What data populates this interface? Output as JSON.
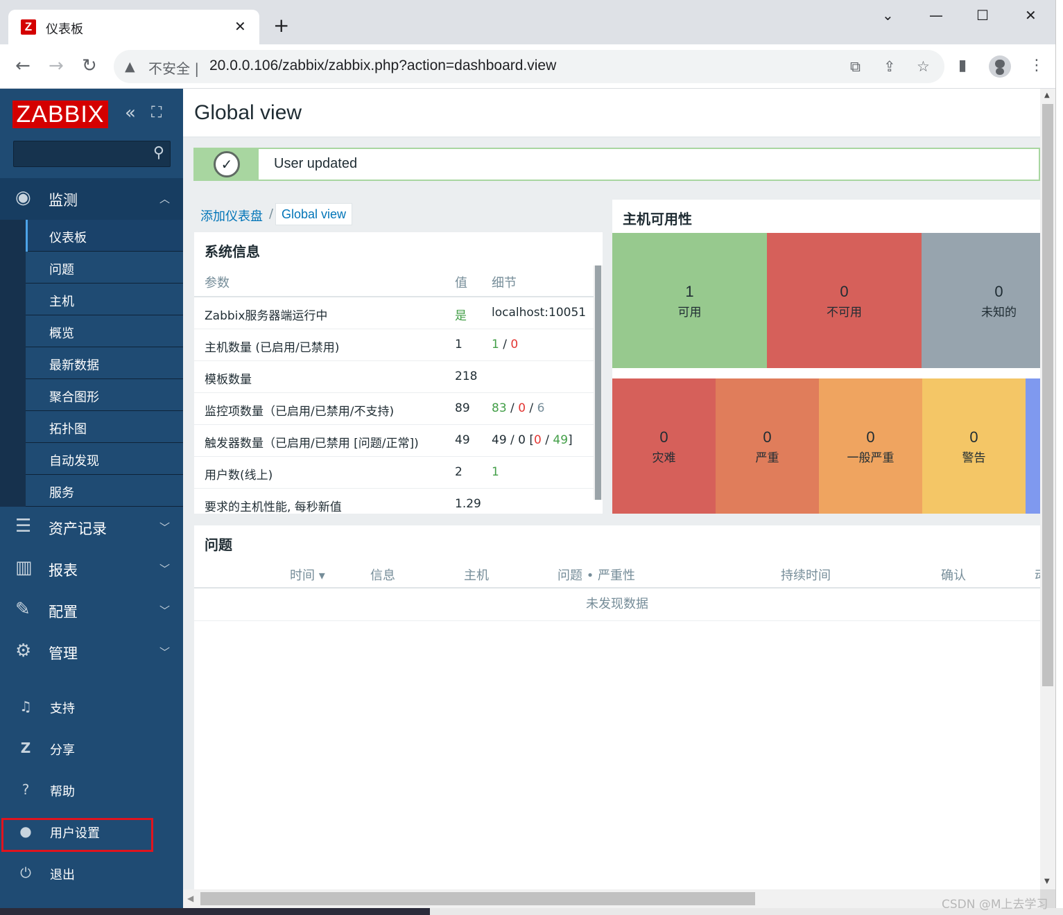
{
  "browser": {
    "tab_title": "仪表板",
    "tab_favicon_letter": "Z",
    "tab_close": "✕",
    "new_tab": "+",
    "security_label": "不安全",
    "url": "20.0.0.106/zabbix/zabbix.php?action=dashboard.view",
    "window_controls": {
      "chevron": "⌄",
      "minimize": "—",
      "maximize": "☐",
      "close": "✕"
    }
  },
  "sidebar": {
    "logo": "ZABBIX",
    "search_placeholder": "",
    "monitoring": {
      "label": "监测",
      "items": [
        "仪表板",
        "问题",
        "主机",
        "概览",
        "最新数据",
        "聚合图形",
        "拓扑图",
        "自动发现",
        "服务"
      ]
    },
    "sections": [
      "资产记录",
      "报表",
      "配置",
      "管理"
    ],
    "bottom": [
      "支持",
      "分享",
      "帮助",
      "用户设置",
      "退出"
    ],
    "highlighted_item": "用户设置"
  },
  "header": {
    "title": "Global view"
  },
  "message": {
    "text": "User updated",
    "type": "success"
  },
  "breadcrumb": {
    "parent": "添加仪表盘",
    "separator": "/",
    "current": "Global view"
  },
  "system_info": {
    "title": "系统信息",
    "columns": [
      "参数",
      "值",
      "细节"
    ],
    "rows": [
      {
        "param": "Zabbix服务器端运行中",
        "value": "是",
        "detail": "localhost:10051"
      },
      {
        "param": "主机数量 (已启用/已禁用)",
        "value": "1",
        "detail_parts": [
          "1",
          " / ",
          "0"
        ]
      },
      {
        "param": "模板数量",
        "value": "218",
        "detail": ""
      },
      {
        "param": "监控项数量（已启用/已禁用/不支持)",
        "value": "89",
        "detail_parts": [
          "83",
          " / ",
          "0",
          " / ",
          "6"
        ]
      },
      {
        "param": "触发器数量（已启用/已禁用 [问题/正常])",
        "value": "49",
        "detail_parts": [
          "49 / 0 [",
          "0",
          " / ",
          "49",
          "]"
        ]
      },
      {
        "param": "用户数(线上)",
        "value": "2",
        "detail": "1"
      },
      {
        "param": "要求的主机性能, 每秒新值",
        "value": "1.29",
        "detail": ""
      }
    ]
  },
  "host_availability": {
    "title": "主机可用性",
    "tiles": [
      {
        "count": "1",
        "label": "可用",
        "color": "#97c98e"
      },
      {
        "count": "0",
        "label": "不可用",
        "color": "#d6605a"
      },
      {
        "count": "0",
        "label": "未知的",
        "color": "#97a4ae"
      }
    ],
    "severity_tiles": [
      {
        "count": "0",
        "label": "灾难",
        "color": "#d6605a"
      },
      {
        "count": "0",
        "label": "严重",
        "color": "#e07d5b"
      },
      {
        "count": "0",
        "label": "一般严重",
        "color": "#efa460"
      },
      {
        "count": "0",
        "label": "警告",
        "color": "#f4c666"
      },
      {
        "count": "",
        "label": "",
        "color": "#7f99ef"
      }
    ]
  },
  "problems": {
    "title": "问题",
    "columns": [
      "时间 ▾",
      "信息",
      "主机",
      "问题 • 严重性",
      "持续时间",
      "确认",
      "动"
    ],
    "empty_text": "未发现数据"
  },
  "watermark": "CSDN @M上去学习"
}
